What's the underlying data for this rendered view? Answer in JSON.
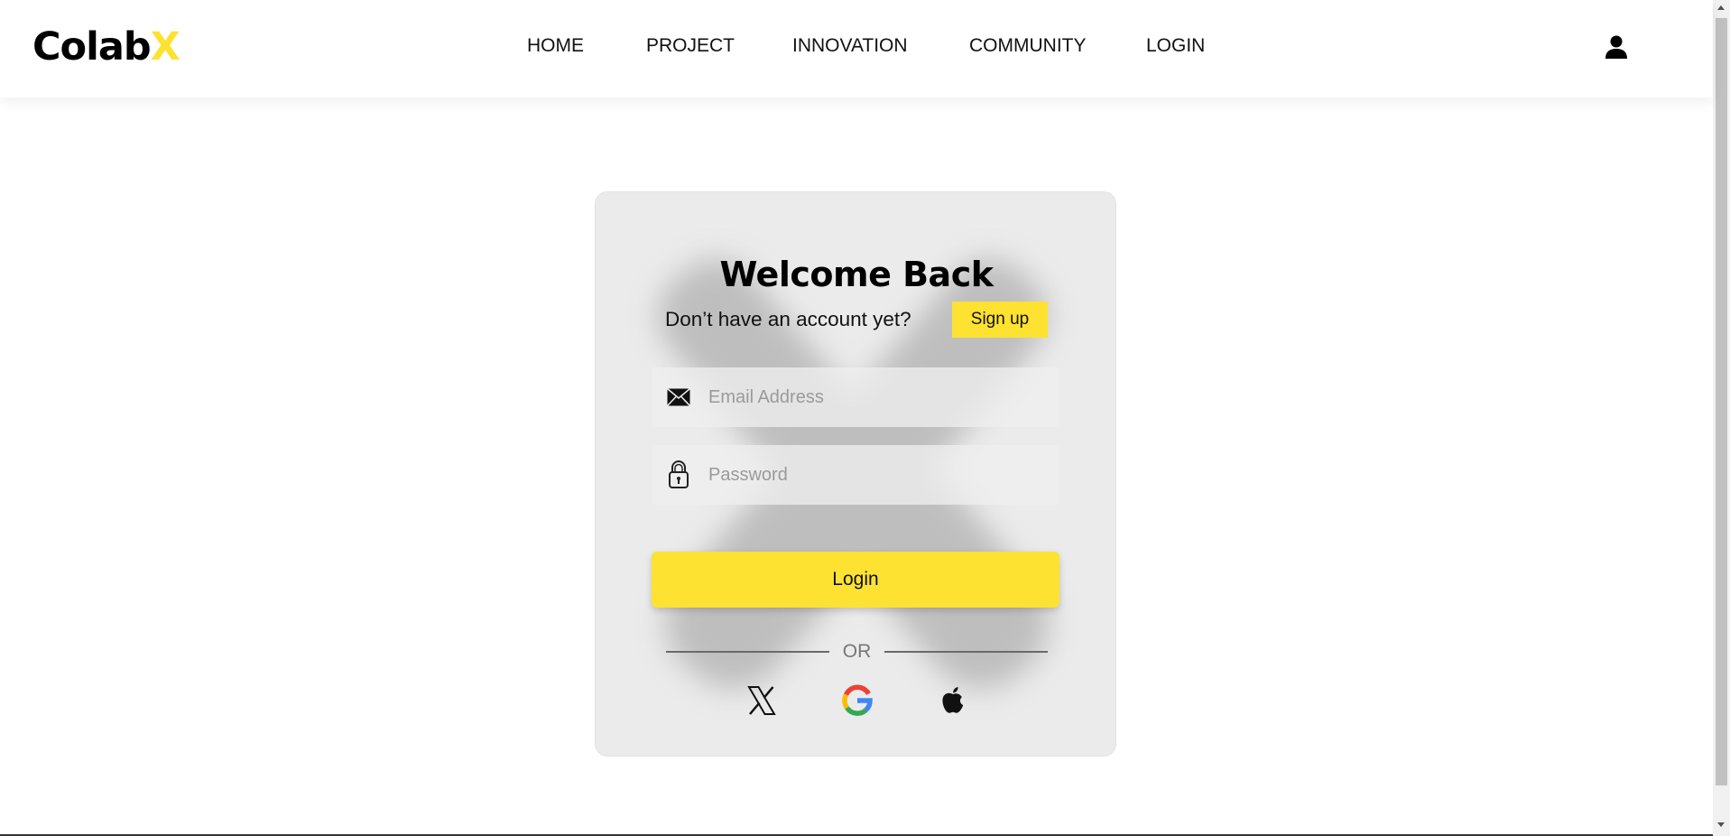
{
  "brand": {
    "name": "Colab",
    "accent_letter": "X",
    "accent_color": "#fde232"
  },
  "nav": {
    "items": [
      {
        "label": "HOME"
      },
      {
        "label": "PROJECT"
      },
      {
        "label": "INNOVATION"
      },
      {
        "label": "COMMUNITY"
      },
      {
        "label": "LOGIN"
      }
    ],
    "user_icon": "user-icon"
  },
  "login_card": {
    "title": "Welcome Back",
    "signup_prompt": "Don’t have an account yet?",
    "signup_label": "Sign up",
    "email": {
      "placeholder": "Email Address",
      "value": "",
      "icon": "envelope-icon"
    },
    "password": {
      "placeholder": "Password",
      "value": "",
      "icon": "lock-icon"
    },
    "login_label": "Login",
    "divider_label": "OR",
    "social": [
      {
        "icon": "x-icon"
      },
      {
        "icon": "google-icon"
      },
      {
        "icon": "apple-icon"
      }
    ]
  },
  "colors": {
    "accent": "#fde232",
    "card_bg": "#ebebeb",
    "page_bg": "#ffffff"
  }
}
